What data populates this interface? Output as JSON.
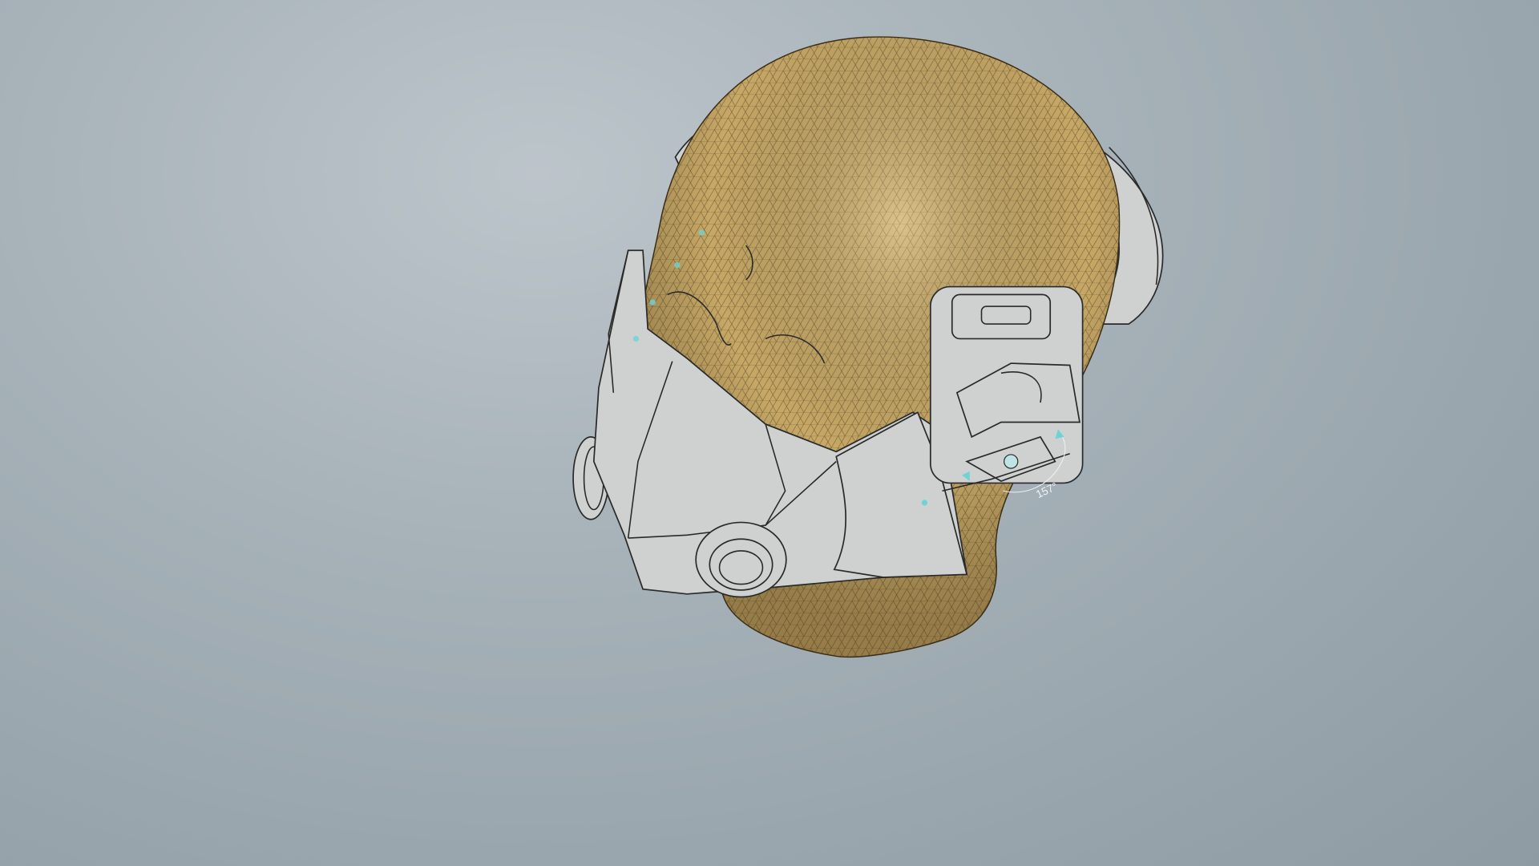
{
  "viewport": {
    "background_color": "#a6b1b8",
    "mesh_color": "#c7a866",
    "part_color": "#cfd1d1",
    "annotation_color": "#6fd3d6"
  },
  "annotations": {
    "angle_label": "157°"
  }
}
